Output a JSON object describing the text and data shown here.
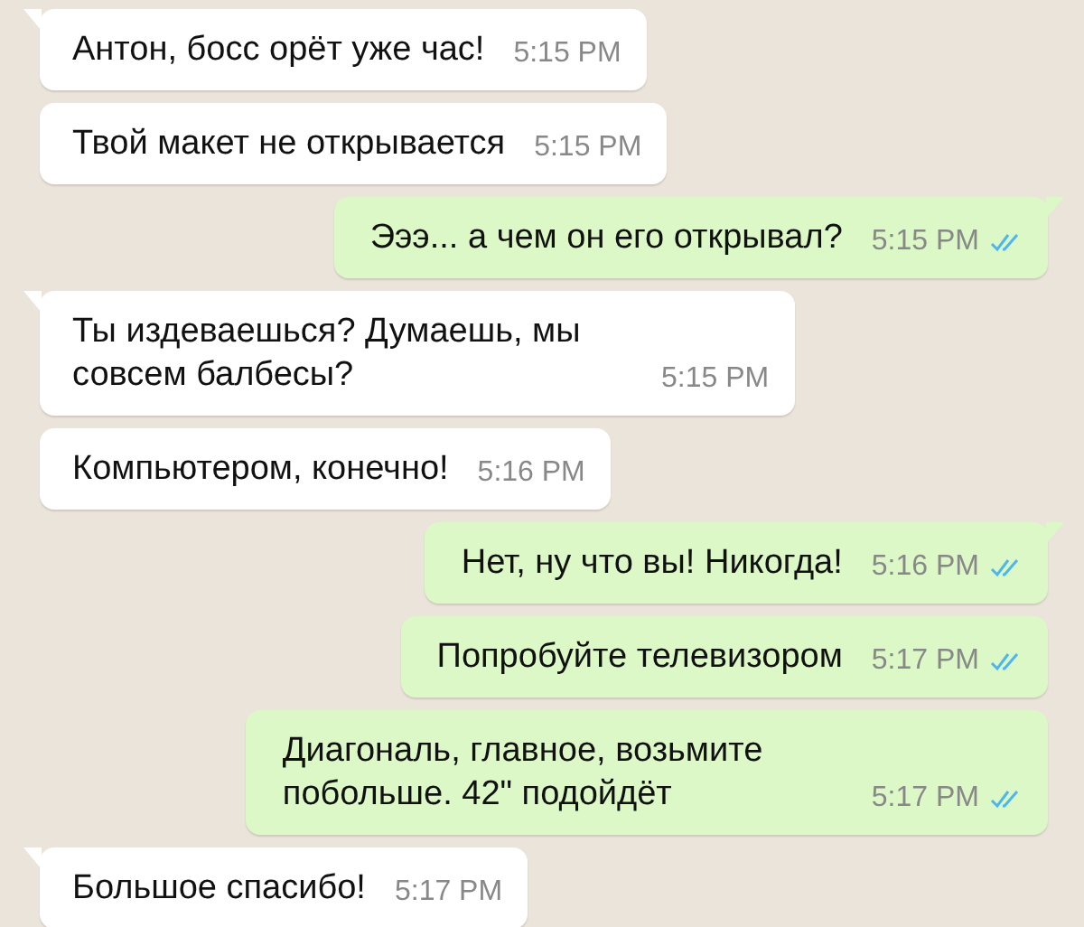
{
  "messages": [
    {
      "kind": "incoming",
      "tail": true,
      "text": "Антон, босс орёт уже час!",
      "time": "5:15 PM"
    },
    {
      "kind": "incoming",
      "tail": false,
      "text": "Твой макет не открывается",
      "time": "5:15 PM"
    },
    {
      "kind": "outgoing",
      "tail": true,
      "text": "Эээ... а чем он его открывал?",
      "time": "5:15 PM",
      "read": true
    },
    {
      "kind": "incoming",
      "tail": true,
      "text": "Ты издеваешься? Думаешь, мы совсем балбесы?",
      "time": "5:15 PM"
    },
    {
      "kind": "incoming",
      "tail": false,
      "text": "Компьютером, конечно!",
      "time": "5:16 PM"
    },
    {
      "kind": "outgoing",
      "tail": true,
      "text": "Нет, ну что вы! Никогда!",
      "time": "5:16 PM",
      "read": true
    },
    {
      "kind": "outgoing",
      "tail": false,
      "text": "Попробуйте телевизором",
      "time": "5:17 PM",
      "read": true
    },
    {
      "kind": "outgoing",
      "tail": false,
      "text": "Диагональ, главное, возьмите побольше. 42\" подойдёт",
      "time": "5:17 PM",
      "read": true
    },
    {
      "kind": "incoming",
      "tail": true,
      "text": "Большое спасибо!",
      "time": "5:17 PM"
    }
  ]
}
